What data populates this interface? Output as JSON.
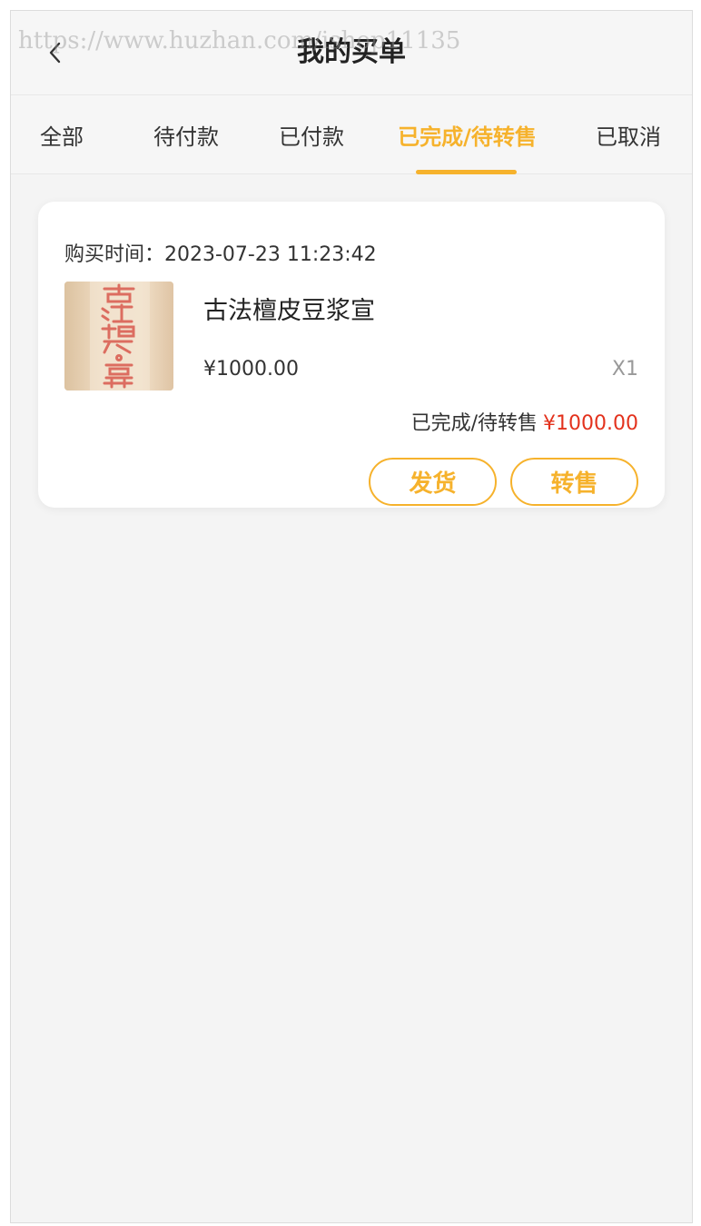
{
  "header": {
    "title": "我的买单",
    "watermark": "https://www.huzhan.com/ishop11135"
  },
  "tabs": [
    {
      "label": "全部",
      "active": false
    },
    {
      "label": "待付款",
      "active": false
    },
    {
      "label": "已付款",
      "active": false
    },
    {
      "label": "已完成/待转售",
      "active": true
    },
    {
      "label": "已取消",
      "active": false
    }
  ],
  "order": {
    "purchase_time": "购买时间：2023-07-23 11:23:42",
    "product_name": "古法檀皮豆浆宣",
    "price": "¥1000.00",
    "quantity": "X1",
    "status": "已完成/待转售",
    "total": "¥1000.00",
    "thumb_text": "古法檀皮豆浆宣",
    "buttons": {
      "ship": "发货",
      "resell": "转售"
    }
  },
  "colors": {
    "accent": "#f6b22c",
    "price_red": "#e3321d",
    "background": "#f4f4f4"
  }
}
